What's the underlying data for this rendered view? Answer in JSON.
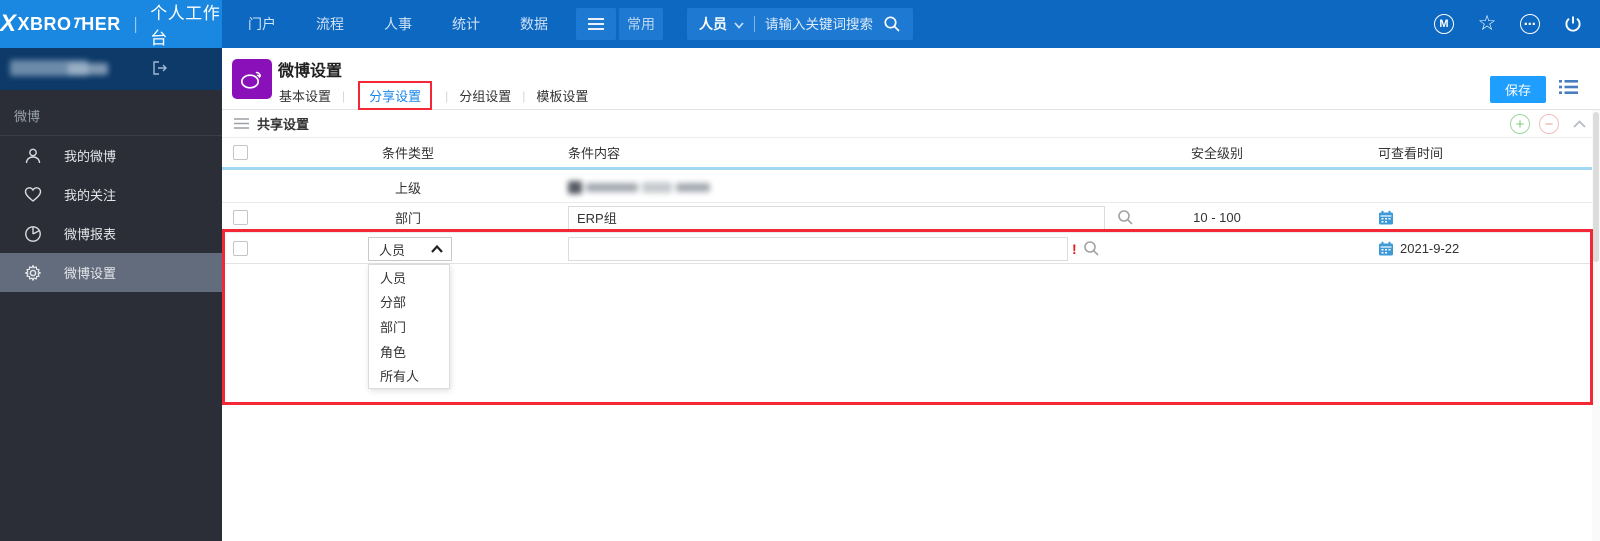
{
  "topbar": {
    "brand": {
      "name_head": "XBRO",
      "name_tail": "HER",
      "separator": "｜",
      "workspace": "个人工作台"
    },
    "nav_items": [
      "门户",
      "流程",
      "人事",
      "统计",
      "数据"
    ],
    "common_button": "常用",
    "search": {
      "category": "人员",
      "placeholder": "请输入关键词搜索"
    },
    "right_icons": [
      "m-circle-icon",
      "star-icon",
      "more-circle-icon",
      "power-icon"
    ]
  },
  "sidebar": {
    "user_area_censored": true,
    "section_label": "微博",
    "items": [
      {
        "label": "我的微博",
        "icon": "user-icon",
        "selected": false
      },
      {
        "label": "我的关注",
        "icon": "heart-icon",
        "selected": false
      },
      {
        "label": "微博报表",
        "icon": "pie-chart-icon",
        "selected": false
      },
      {
        "label": "微博设置",
        "icon": "gear-icon",
        "selected": true
      }
    ]
  },
  "main": {
    "title": "微博设置",
    "tabs": [
      {
        "label": "基本设置",
        "active": false
      },
      {
        "label": "分享设置",
        "active": true,
        "annotated_red_box": true
      },
      {
        "label": "分组设置",
        "active": false
      },
      {
        "label": "模板设置",
        "active": false
      }
    ],
    "save_button": "保存",
    "section": {
      "title": "共享设置",
      "actions": [
        "add-circle-icon",
        "remove-circle-icon",
        "collapse-chevron-icon"
      ]
    },
    "table": {
      "columns": [
        "条件类型",
        "条件内容",
        "安全级别",
        "可查看时间"
      ],
      "rows": [
        {
          "type": "上级",
          "content_censored": true,
          "security": "",
          "time": ""
        },
        {
          "type": "部门",
          "content": "ERP组",
          "security": "10 - 100",
          "time": ""
        },
        {
          "type_select": {
            "selected": "人员",
            "open": true,
            "options": [
              "人员",
              "分部",
              "部门",
              "角色",
              "所有人"
            ]
          },
          "content": "",
          "validation_mark": "!",
          "security": "",
          "time": "2021-9-22"
        }
      ]
    }
  },
  "colors": {
    "topbar_bg": "#0d68c2",
    "logo_bg": "#1a87e0",
    "topbar_button_bg": "#1d79d2",
    "sidebar_bg": "#2b2e36",
    "sidebar_user_bg": "#0d3a69",
    "sidebar_selected_bg": "#636c7d",
    "app_tile_purple": "#8a11b9",
    "active_tab_blue": "#1a86e8",
    "save_button_blue": "#1e9fff",
    "annotation_red": "#f32735",
    "header_underline_blue": "#a3d8f3",
    "calendar_blue": "#3d9ad7",
    "plus_green": "#7ccc7c",
    "minus_pink": "#eda3a3"
  }
}
